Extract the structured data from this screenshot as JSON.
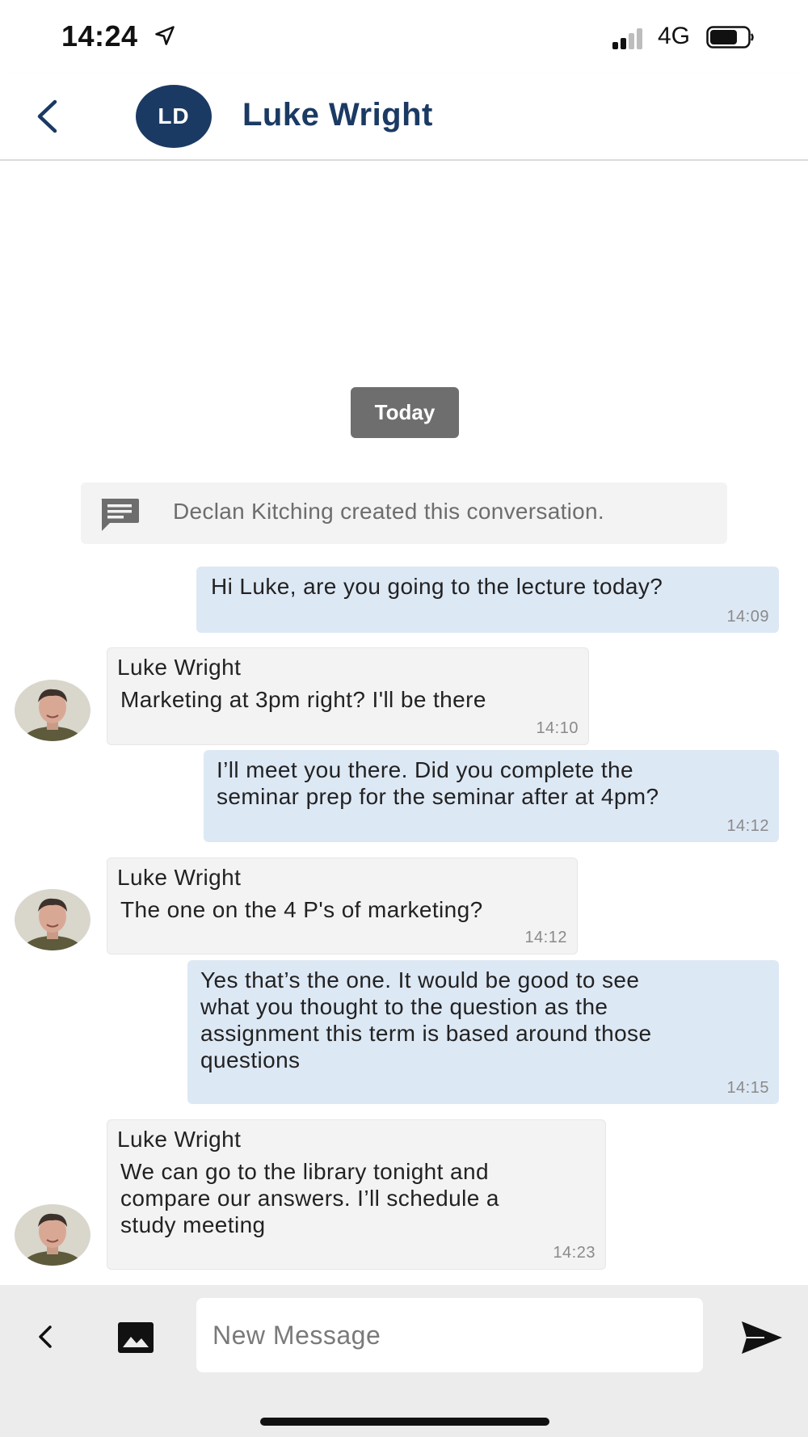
{
  "status_bar": {
    "time": "14:24",
    "network": "4G",
    "icons": {
      "location": "location-arrow-icon",
      "signal": "cellular-signal-icon",
      "battery": "battery-icon"
    }
  },
  "header": {
    "back_icon": "chevron-left-icon",
    "avatar_initials": "LD",
    "contact_name": "Luke Wright",
    "accent_color": "#1b3a63"
  },
  "chat": {
    "date_separator": "Today",
    "system_message": {
      "icon": "chat-bubble-icon",
      "text": "Declan Kitching created this conversation."
    },
    "messages": [
      {
        "direction": "outgoing",
        "text": "Hi Luke, are you going to the lecture today?",
        "time": "14:09"
      },
      {
        "direction": "incoming",
        "sender": "Luke Wright",
        "text": "Marketing at 3pm right? I'll be there",
        "time": "14:10"
      },
      {
        "direction": "outgoing",
        "text": "I’ll meet you there. Did you complete the\nseminar prep for the seminar after at 4pm?",
        "time": "14:12"
      },
      {
        "direction": "incoming",
        "sender": "Luke Wright",
        "text": "The one on the 4 P's of marketing?",
        "time": "14:12"
      },
      {
        "direction": "outgoing",
        "text": "Yes that’s the one. It would be good to see\nwhat you thought to the question as the\nassignment this term is based around those\nquestions",
        "time": "14:15"
      },
      {
        "direction": "incoming",
        "sender": "Luke Wright",
        "text": "We can go to the library tonight and\ncompare our answers. I’ll schedule a\nstudy meeting",
        "time": "14:23"
      }
    ],
    "colors": {
      "outgoing_bubble": "#dde8f5",
      "incoming_bubble": "#f3f3f3"
    }
  },
  "input_bar": {
    "back_icon": "chevron-left-icon",
    "image_icon": "image-icon",
    "placeholder": "New Message",
    "value": "",
    "send_icon": "send-icon"
  }
}
